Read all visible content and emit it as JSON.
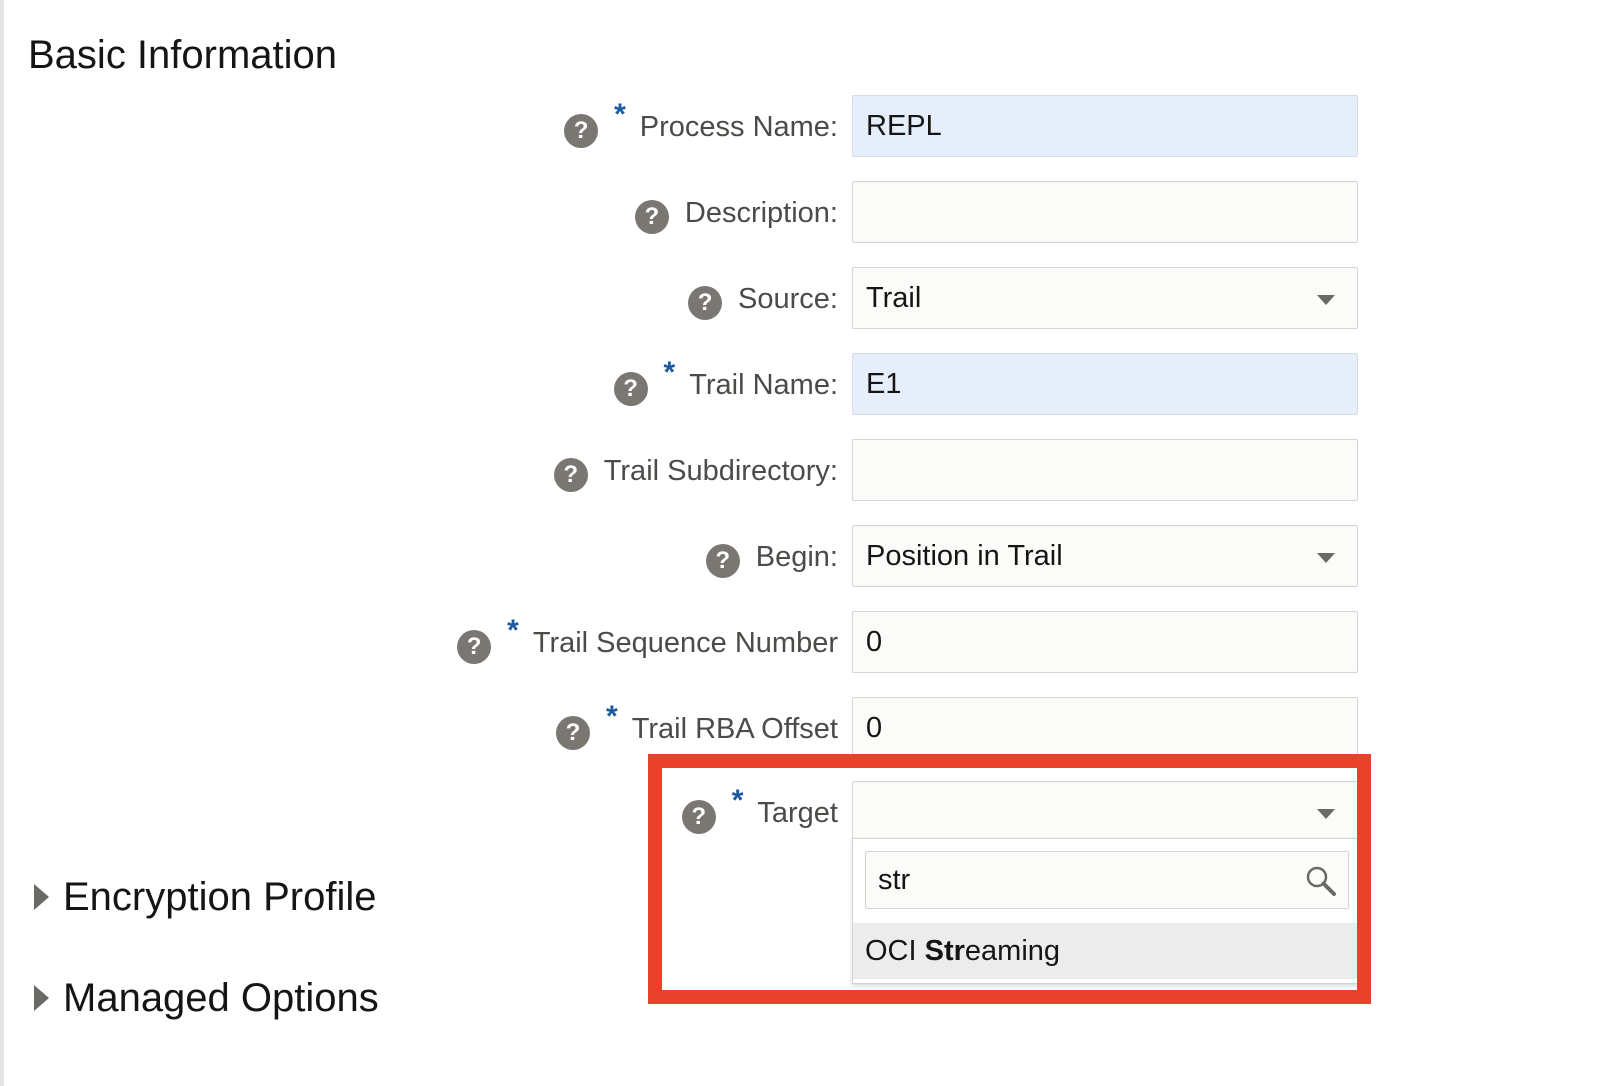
{
  "section": {
    "title": "Basic Information"
  },
  "fields": {
    "process_name": {
      "label": "Process Name:",
      "value": "REPL",
      "required": true
    },
    "description": {
      "label": "Description:",
      "value": ""
    },
    "source": {
      "label": "Source:",
      "value": "Trail"
    },
    "trail_name": {
      "label": "Trail Name:",
      "value": "E1",
      "required": true
    },
    "trail_subdirectory": {
      "label": "Trail Subdirectory:",
      "value": ""
    },
    "begin": {
      "label": "Begin:",
      "value": "Position in Trail"
    },
    "trail_sequence_number": {
      "label": "Trail Sequence Number",
      "value": "0",
      "required": true
    },
    "trail_rba_offset": {
      "label": "Trail RBA Offset",
      "value": "0",
      "required": true
    },
    "target": {
      "label": "Target",
      "value": "",
      "required": true
    }
  },
  "target_dropdown": {
    "search_value": "str",
    "option": {
      "prefix": "OCI ",
      "match": "Str",
      "suffix": "eaming"
    }
  },
  "collapsibles": {
    "encryption_profile": "Encryption Profile",
    "managed_options": "Managed Options"
  },
  "icons": {
    "help": "?",
    "required": "*"
  },
  "colors": {
    "highlight": "#e8412c",
    "required_star": "#1a5aa0",
    "autofill_bg": "#e6eefc"
  }
}
